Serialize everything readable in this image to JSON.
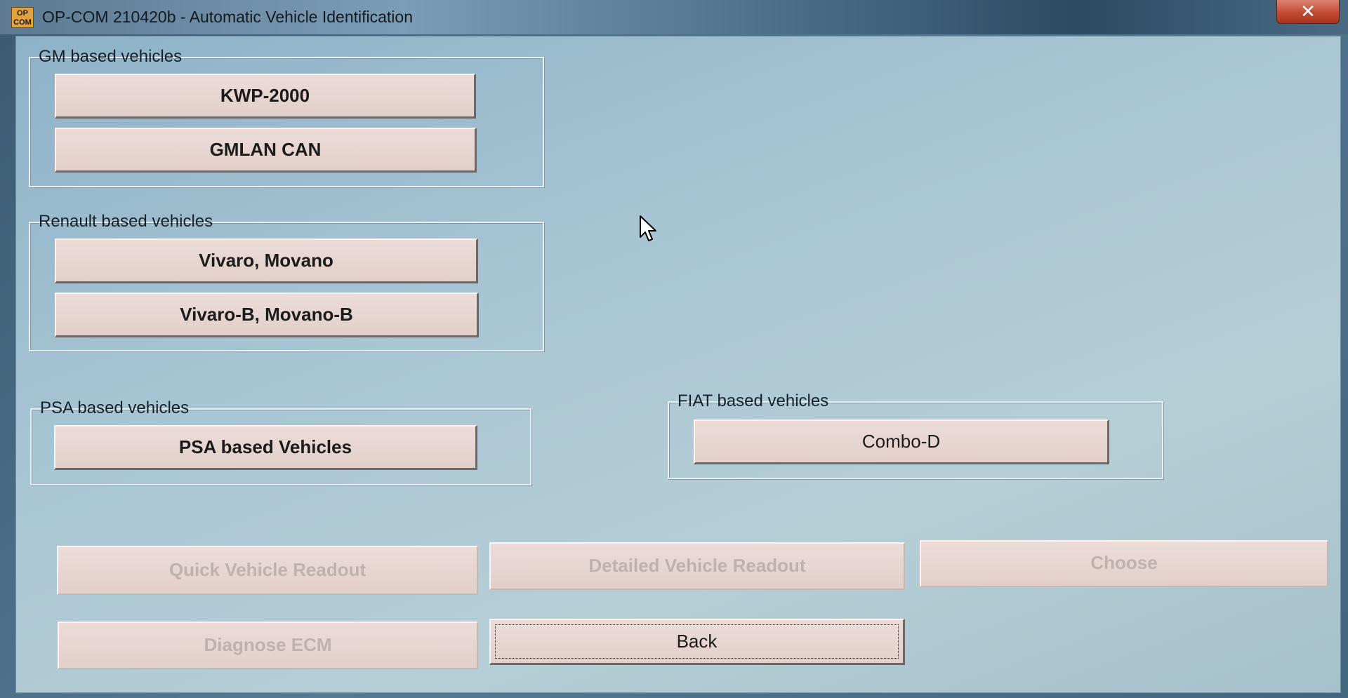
{
  "window": {
    "title": "OP-COM 210420b - Automatic Vehicle Identification",
    "icon_text_top": "OP",
    "icon_text_bottom": "COM",
    "close_label": "✕"
  },
  "groups": {
    "gm": {
      "label": "GM based vehicles",
      "buttons": [
        "KWP-2000",
        "GMLAN CAN"
      ]
    },
    "renault": {
      "label": "Renault based vehicles",
      "buttons": [
        "Vivaro, Movano",
        "Vivaro-B, Movano-B"
      ]
    },
    "psa": {
      "label": "PSA based vehicles",
      "buttons": [
        "PSA based Vehicles"
      ]
    },
    "fiat": {
      "label": "FIAT based vehicles",
      "buttons": [
        "Combo-D"
      ]
    }
  },
  "actions": {
    "quick_readout": "Quick Vehicle Readout",
    "detailed_readout": "Detailed Vehicle Readout",
    "choose": "Choose",
    "diagnose_ecm": "Diagnose ECM",
    "back": "Back"
  },
  "colors": {
    "button_face": "#e6d4d0",
    "disabled_text": "#bfb2ae",
    "close_button": "#c24a33",
    "client_background": "#a9c6d4"
  },
  "icons": [
    "app-logo-icon",
    "close-icon",
    "mouse-pointer-icon"
  ]
}
